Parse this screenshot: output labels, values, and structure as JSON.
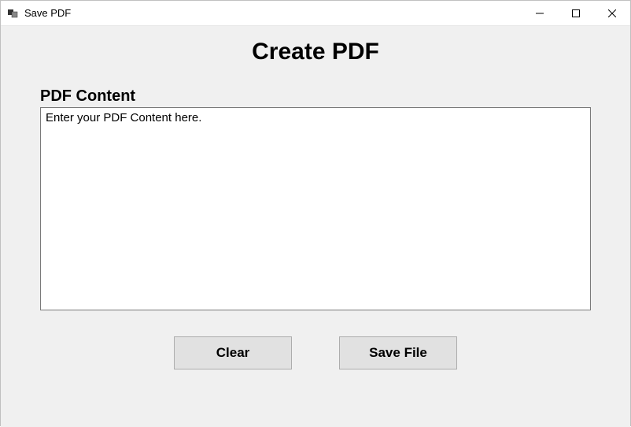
{
  "window": {
    "title": "Save PDF"
  },
  "main": {
    "heading": "Create PDF",
    "section_label": "PDF Content",
    "textarea_value": "Enter your PDF Content here."
  },
  "buttons": {
    "clear_label": "Clear",
    "save_label": "Save File"
  }
}
